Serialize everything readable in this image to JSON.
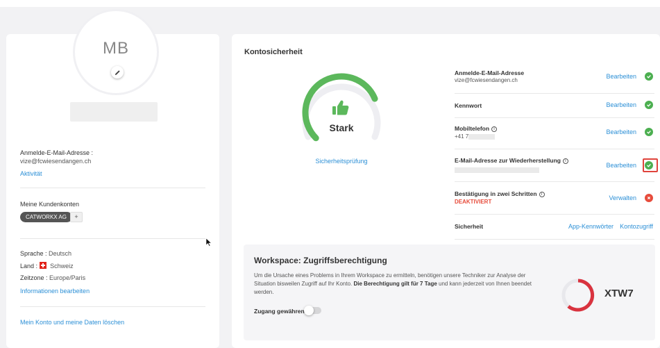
{
  "profile": {
    "initials": "MB",
    "login_email_label": "Anmelde-E-Mail-Adresse :",
    "login_email": "vize@fcwiesendangen.ch",
    "activity_link": "Aktivität",
    "accounts_label": "Meine Kundenkonten",
    "account_chip": "CATWORKX AG",
    "add_account": "+",
    "language_label": "Sprache :",
    "language_value": "Deutsch",
    "country_label": "Land :",
    "country_value": "Schweiz",
    "timezone_label": "Zeitzone :",
    "timezone_value": "Europe/Paris",
    "edit_info_link": "Informationen bearbeiten",
    "delete_link": "Mein Konto und meine Daten löschen"
  },
  "security": {
    "title": "Kontosicherheit",
    "strength": "Stark",
    "strength_level": 0.75,
    "check_link": "Sicherheitsprüfung",
    "rows": [
      {
        "label": "Anmelde-E-Mail-Adresse",
        "sub": "vize@fcwiesendangen.ch",
        "action": "Bearbeiten",
        "status": "ok"
      },
      {
        "label": "Kennwort",
        "action": "Bearbeiten",
        "status": "ok"
      },
      {
        "label": "Mobiltelefon",
        "sub": "+41 7",
        "action": "Bearbeiten",
        "status": "ok"
      },
      {
        "label": "E-Mail-Adresse zur Wiederherstellung",
        "action": "Bearbeiten",
        "status": "ok"
      },
      {
        "label": "Bestätigung in zwei Schritten",
        "sub": "DEAKTIVIERT",
        "action": "Verwalten",
        "status": "bad"
      },
      {
        "label": "Sicherheit",
        "action": "App-Kennwörter",
        "action2": "Kontozugriff"
      }
    ],
    "info_glyph": "i"
  },
  "workspace": {
    "title": "Workspace: Zugriffsberechtigung",
    "text_1": "Um die Ursache eines Problems in Ihrem Workspace zu ermitteln, benötigen unsere Techniker zur Analyse der Situation bisweilen Zugriff auf Ihr Konto. ",
    "text_bold": "Die Berechtigung gilt für 7 Tage",
    "text_2": " und kann jederzeit von Ihnen beendet werden.",
    "access_label": "Zugang gewähren",
    "code": "XTW7"
  },
  "colors": {
    "accent": "#2b8fd6",
    "ok": "#4caf50",
    "bad": "#e74c3c",
    "gauge": "#5cb85c",
    "ring_red": "#d9333f"
  }
}
